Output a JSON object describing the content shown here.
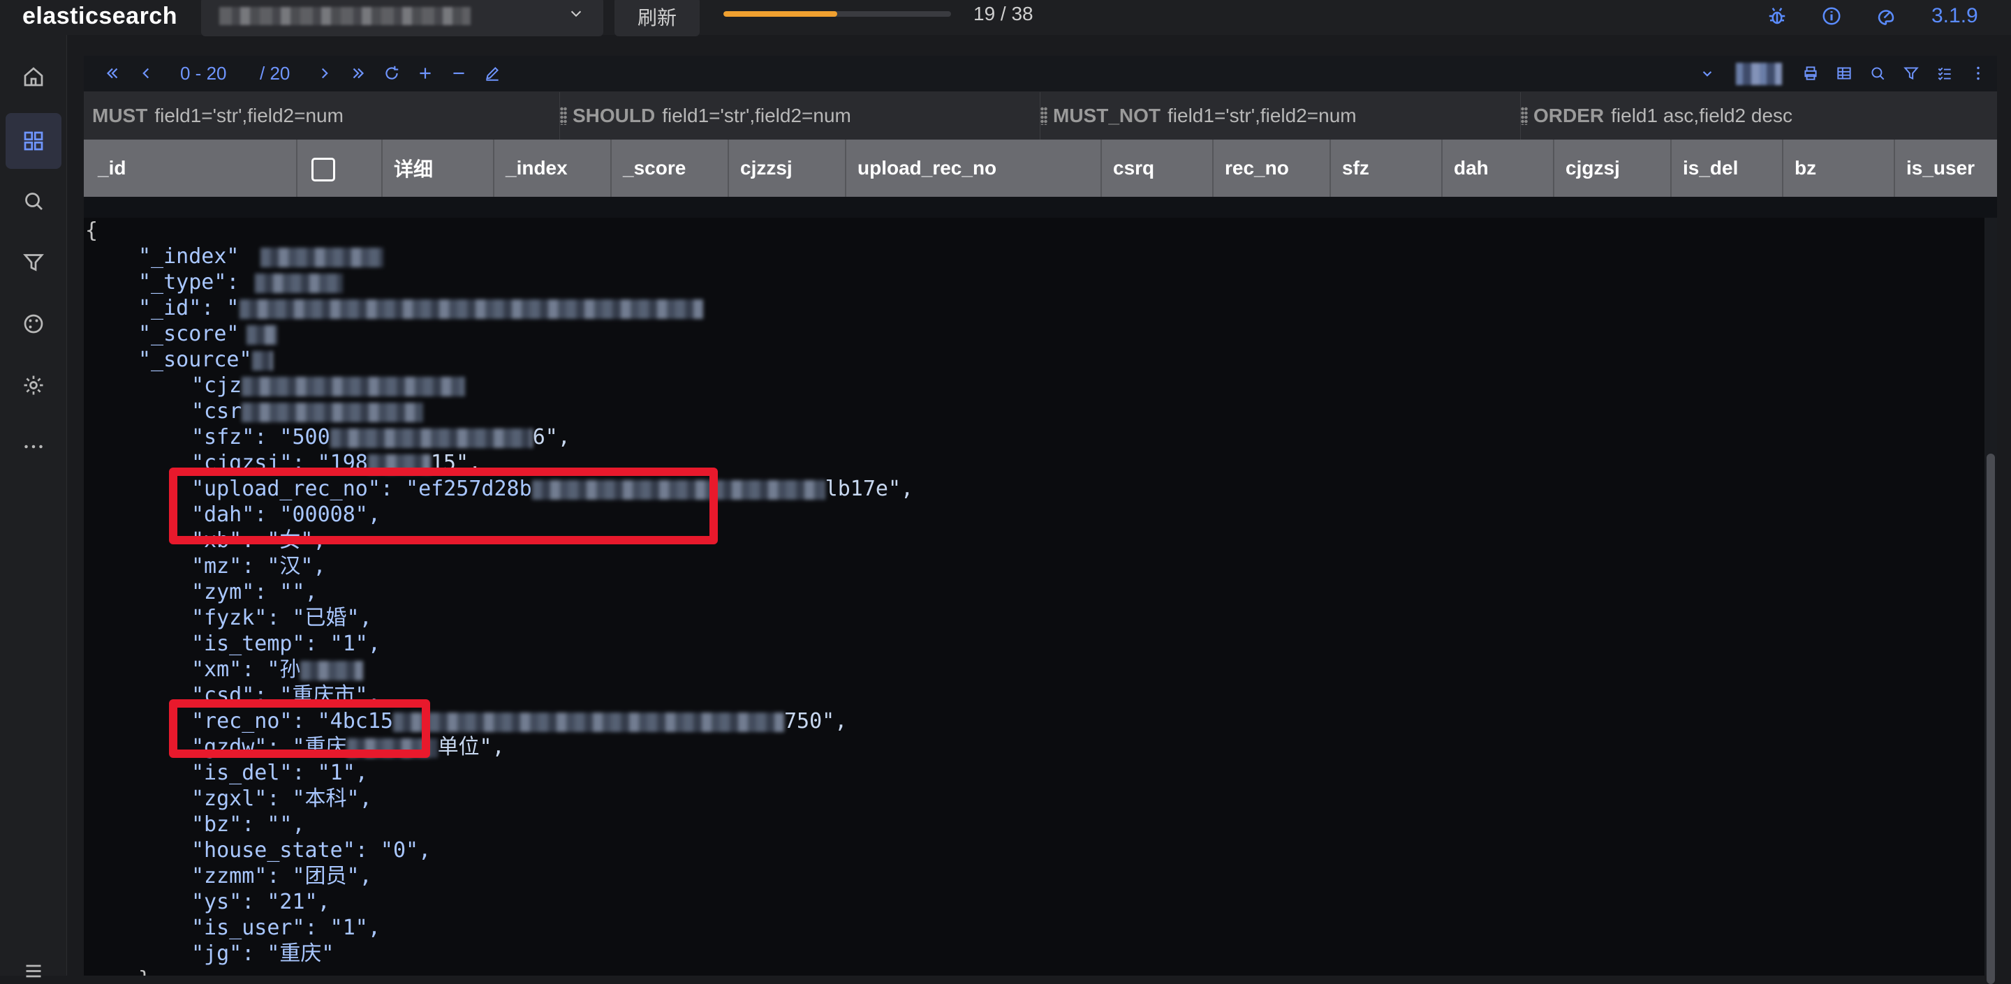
{
  "app": {
    "title": "elasticsearch",
    "version": "3.1.9"
  },
  "topbar": {
    "refresh_label": "刷新",
    "progress": {
      "current": 19,
      "total": 38,
      "text": "19 / 38"
    }
  },
  "toolbar": {
    "page_range": "0 - 20",
    "page_total": "/ 20"
  },
  "query": {
    "must": {
      "label": "MUST",
      "placeholder": "field1='str',field2=num"
    },
    "should": {
      "label": "SHOULD",
      "placeholder": "field1='str',field2=num"
    },
    "must_not": {
      "label": "MUST_NOT",
      "placeholder": "field1='str',field2=num"
    },
    "order": {
      "label": "ORDER",
      "placeholder": "field1 asc,field2 desc"
    }
  },
  "columns": [
    "_id",
    "详细",
    "_index",
    "_score",
    "cjzzsj",
    "upload_rec_no",
    "csrq",
    "rec_no",
    "sfz",
    "dah",
    "cjgzsj",
    "is_del",
    "bz",
    "is_user"
  ],
  "json": {
    "open": "{",
    "l1": "\"_index\"",
    "l2": "\"_type\":",
    "l3": "\"_id\": \"",
    "l4": "\"_score\"",
    "l5": "\"_source\"",
    "l6": "\"cjz",
    "l7": "\"csr",
    "l8a": "\"sfz\": \"500",
    "l8b": "6\",",
    "l9a": "\"cjgzsj\": \"198",
    "l9b": "15\",",
    "l10a": "\"upload_rec_no\": \"ef257d28b",
    "l10b": "lb17e\",",
    "dah": "\"dah\": \"00008\",",
    "xb": "\"xb\": \"女\",",
    "mz": "\"mz\": \"汉\",",
    "zym": "\"zym\": \"\",",
    "fyzk": "\"fyzk\": \"已婚\",",
    "is_temp": "\"is_temp\": \"1\",",
    "xm": "\"xm\": \"孙",
    "csd": "\"csd\": \"重庆市\",",
    "rec_no_a": "\"rec_no\": \"4bc15",
    "rec_no_b": "750\",",
    "gzdw_a": "\"gzdw\": \"重庆",
    "gzdw_b": "单位\",",
    "is_del": "\"is_del\": \"1\",",
    "zgxl": "\"zgxl\": \"本科\",",
    "bz": "\"bz\": \"\",",
    "house_state": "\"house_state\": \"0\",",
    "zzmm": "\"zzmm\": \"团员\",",
    "ys": "\"ys\": \"21\",",
    "is_user": "\"is_user\": \"1\",",
    "jg": "\"jg\": \"重庆\"",
    "close": "}"
  },
  "colors": {
    "accent": "#5b8cff",
    "progress": "#f0a030",
    "highlight": "#e8192c"
  },
  "icons": {
    "sidebar": [
      "home-icon",
      "grid-icon",
      "search-icon",
      "filter-icon",
      "palette-icon",
      "gear-icon",
      "more-icon"
    ],
    "topbar": [
      "bug-icon",
      "info-icon",
      "theme-icon"
    ],
    "toolbar": [
      "first-page-icon",
      "prev-page-icon",
      "next-page-icon",
      "last-page-icon",
      "reload-icon",
      "add-icon",
      "remove-icon",
      "edit-icon",
      "chevron-down-icon",
      "print-icon",
      "table-icon",
      "search-icon",
      "filter-icon",
      "checklist-icon",
      "more-icon"
    ]
  }
}
